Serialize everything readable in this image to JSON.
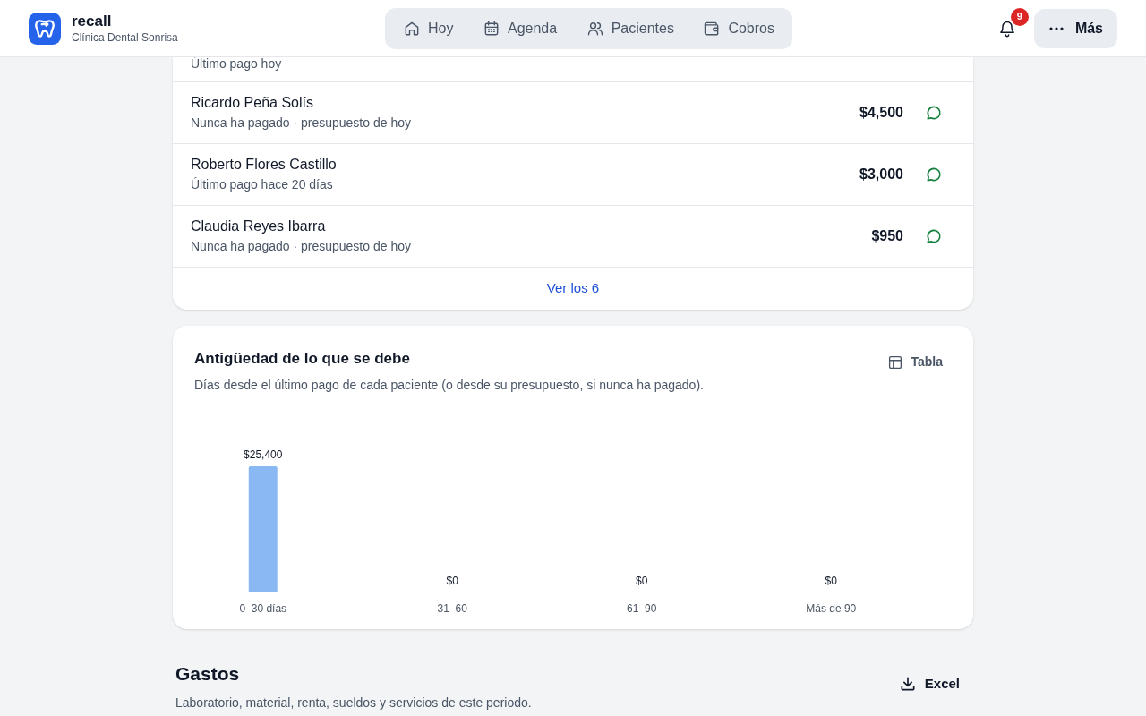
{
  "header": {
    "app_name": "recall",
    "clinic": "Clínica Dental Sonrisa",
    "nav": [
      {
        "label": "Hoy",
        "selected": false
      },
      {
        "label": "Agenda",
        "selected": false
      },
      {
        "label": "Pacientes",
        "selected": false
      },
      {
        "label": "Cobros",
        "selected": false
      }
    ],
    "notifications": "9",
    "more": "Más"
  },
  "debtors": {
    "rows": [
      {
        "detail": "Último pago hoy"
      },
      {
        "name": "Ricardo Peña Solís",
        "detail": "Nunca ha pagado · presupuesto de hoy",
        "amount": "$4,500"
      },
      {
        "name": "Roberto Flores Castillo",
        "detail": "Último pago hace 20 días",
        "amount": "$3,000"
      },
      {
        "name": "Claudia Reyes Ibarra",
        "detail": "Nunca ha pagado · presupuesto de hoy",
        "amount": "$950"
      }
    ],
    "see_all": "Ver los 6"
  },
  "aging": {
    "title": "Antigüedad de lo que se debe",
    "subtitle": "Días desde el último pago de cada paciente (o desde su presupuesto, si nunca ha pagado).",
    "toggle": "Tabla",
    "chart_data": {
      "type": "bar",
      "categories": [
        "0–30 días",
        "31–60",
        "61–90",
        "Más de 90"
      ],
      "values": [
        25400,
        0,
        0,
        0
      ],
      "value_labels": [
        "$25,400",
        "$0",
        "$0",
        "$0"
      ]
    }
  },
  "expenses": {
    "title": "Gastos",
    "subtitle": "Laboratorio, material, renta, sueldos y servicios de este periodo.",
    "export": "Excel"
  }
}
